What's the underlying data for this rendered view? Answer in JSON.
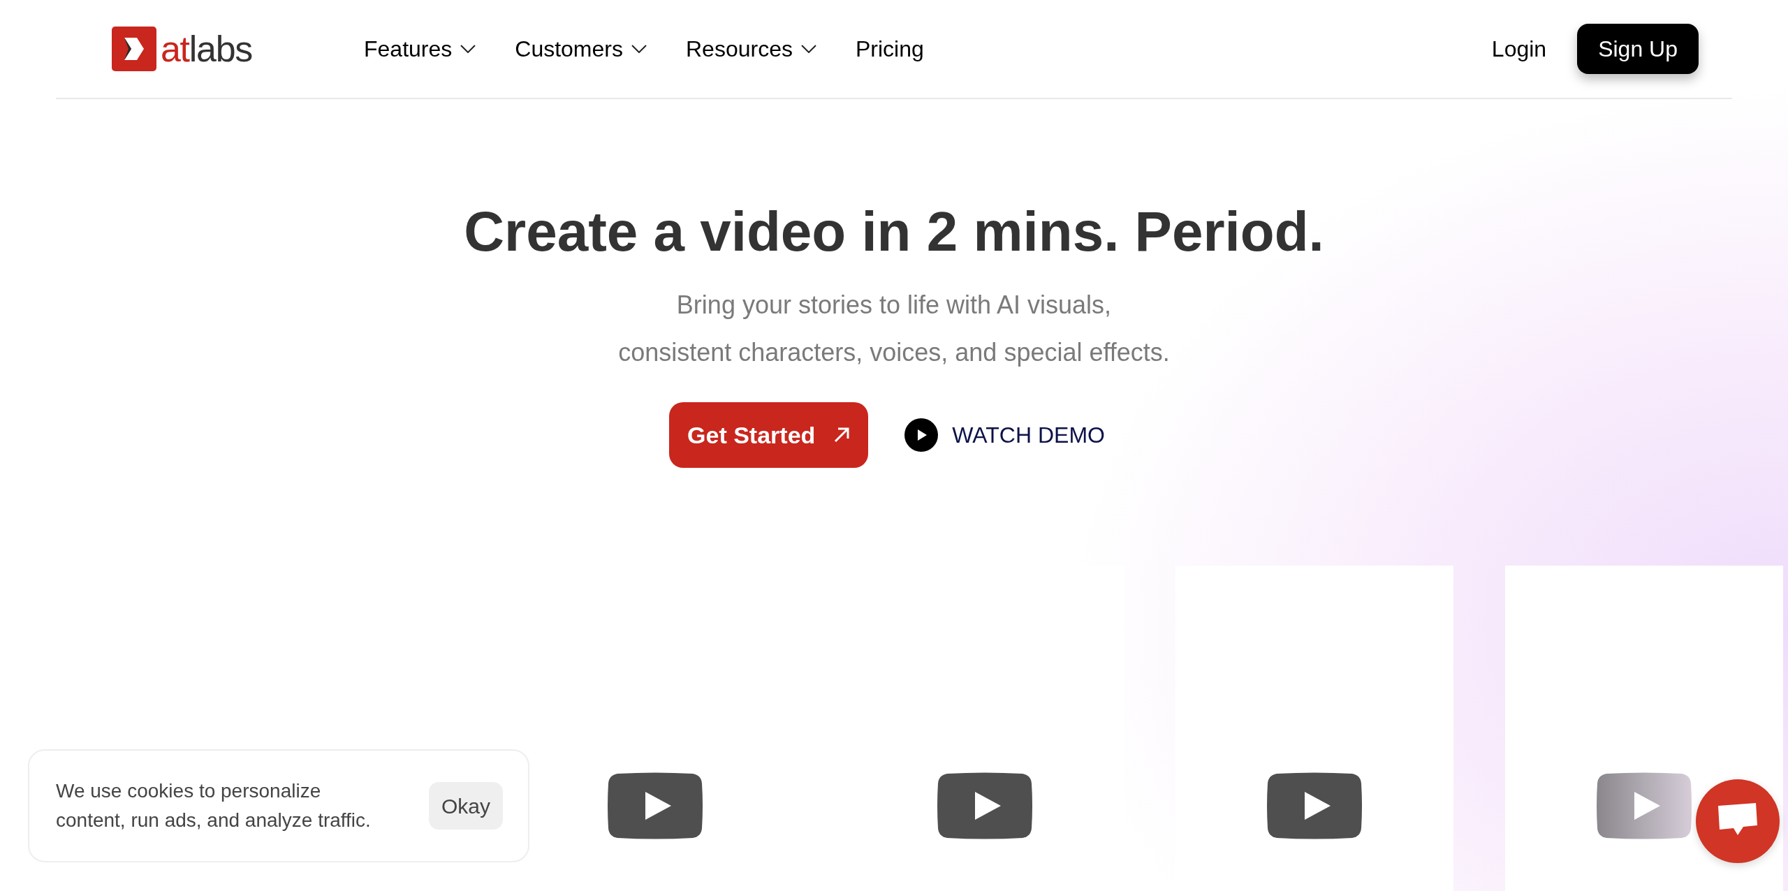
{
  "logo": {
    "accent": "at",
    "rest": "labs"
  },
  "nav": [
    {
      "label": "Features",
      "dropdown": true
    },
    {
      "label": "Customers",
      "dropdown": true
    },
    {
      "label": "Resources",
      "dropdown": true
    },
    {
      "label": "Pricing",
      "dropdown": false
    }
  ],
  "auth": {
    "login": "Login",
    "signup": "Sign Up"
  },
  "hero": {
    "title": "Create a video in 2 mins. Period.",
    "subtitle_lines": [
      "Bring your stories to life with AI visuals,",
      "consistent characters, voices, and special effects."
    ],
    "primary_button": "Get Started",
    "secondary_button": "WATCH DEMO"
  },
  "videos": [
    {
      "kind": "video",
      "faded": false
    },
    {
      "kind": "video",
      "faded": false
    },
    {
      "kind": "video",
      "faded": false
    },
    {
      "kind": "video",
      "faded": true
    }
  ],
  "cookie_banner": {
    "text": "We use cookies to personalize content, run ads, and analyze traffic.",
    "button": "Okay"
  }
}
